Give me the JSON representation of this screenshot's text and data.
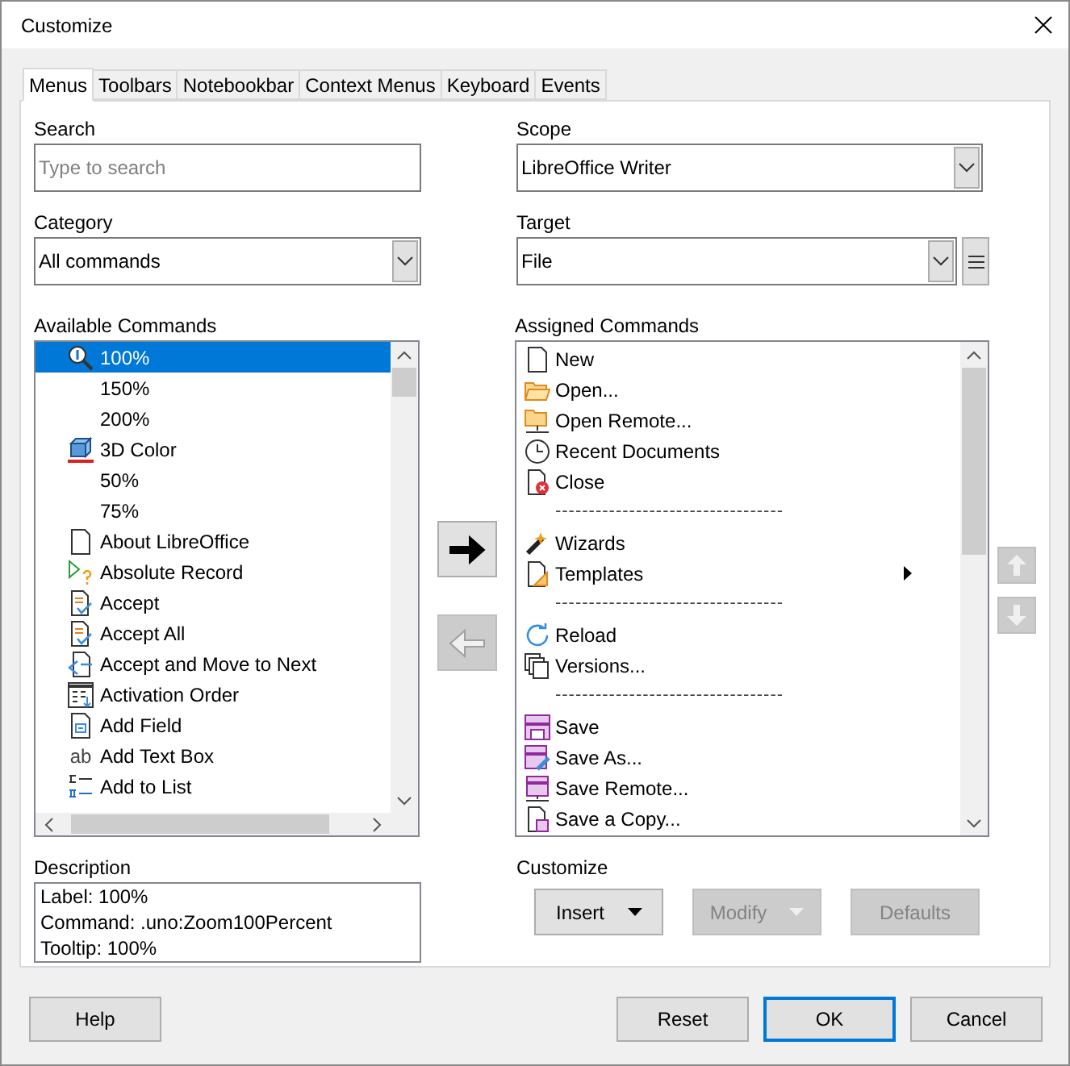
{
  "window": {
    "title": "Customize"
  },
  "tabs": [
    {
      "label": "Menus",
      "selected": true
    },
    {
      "label": "Toolbars",
      "selected": false
    },
    {
      "label": "Notebookbar",
      "selected": false
    },
    {
      "label": "Context Menus",
      "selected": false
    },
    {
      "label": "Keyboard",
      "selected": false
    },
    {
      "label": "Events",
      "selected": false
    }
  ],
  "search": {
    "label": "Search",
    "placeholder": "Type to search"
  },
  "scope": {
    "label": "Scope",
    "value": "LibreOffice Writer"
  },
  "category": {
    "label": "Category",
    "value": "All commands"
  },
  "target": {
    "label": "Target",
    "value": "File"
  },
  "available_commands": {
    "label": "Available Commands",
    "items": [
      {
        "label": "100%",
        "selected": true
      },
      {
        "label": "150%",
        "selected": false
      },
      {
        "label": "200%",
        "selected": false
      },
      {
        "label": "3D Color",
        "selected": false
      },
      {
        "label": "50%",
        "selected": false
      },
      {
        "label": "75%",
        "selected": false
      },
      {
        "label": "About LibreOffice",
        "selected": false
      },
      {
        "label": "Absolute Record",
        "selected": false
      },
      {
        "label": "Accept",
        "selected": false
      },
      {
        "label": "Accept All",
        "selected": false
      },
      {
        "label": "Accept and Move to Next",
        "selected": false
      },
      {
        "label": "Activation Order",
        "selected": false
      },
      {
        "label": "Add Field",
        "selected": false
      },
      {
        "label": "Add Text Box",
        "selected": false,
        "icon_text": "ab"
      },
      {
        "label": "Add to List",
        "selected": false
      }
    ]
  },
  "assigned_commands": {
    "label": "Assigned Commands",
    "items": [
      {
        "kind": "command",
        "label": "New"
      },
      {
        "kind": "command",
        "label": "Open..."
      },
      {
        "kind": "command",
        "label": "Open Remote..."
      },
      {
        "kind": "command",
        "label": "Recent Documents"
      },
      {
        "kind": "command",
        "label": "Close"
      },
      {
        "kind": "separator",
        "label": "----------------------------------"
      },
      {
        "kind": "command",
        "label": "Wizards"
      },
      {
        "kind": "command",
        "label": "Templates",
        "has_submenu": true
      },
      {
        "kind": "separator",
        "label": "----------------------------------"
      },
      {
        "kind": "command",
        "label": "Reload"
      },
      {
        "kind": "command",
        "label": "Versions..."
      },
      {
        "kind": "separator",
        "label": "----------------------------------"
      },
      {
        "kind": "command",
        "label": "Save"
      },
      {
        "kind": "command",
        "label": "Save As..."
      },
      {
        "kind": "command",
        "label": "Save Remote..."
      },
      {
        "kind": "command",
        "label": "Save a Copy..."
      }
    ]
  },
  "add_button": {
    "disabled": false
  },
  "remove_button": {
    "disabled": true
  },
  "move_up_button": {
    "disabled": true
  },
  "move_down_button": {
    "disabled": true
  },
  "description": {
    "label": "Description",
    "lines": [
      "Label: 100%",
      "Command: .uno:Zoom100Percent",
      "Tooltip: 100%"
    ]
  },
  "customize": {
    "label": "Customize",
    "buttons": [
      {
        "label": "Insert",
        "disabled": false,
        "dropdown": true
      },
      {
        "label": "Modify",
        "disabled": true,
        "dropdown": true
      },
      {
        "label": "Defaults",
        "disabled": true,
        "dropdown": false
      }
    ]
  },
  "footer_buttons": [
    {
      "label": "Help",
      "default": false
    },
    {
      "label": "Reset",
      "default": false
    },
    {
      "label": "OK",
      "default": true
    },
    {
      "label": "Cancel",
      "default": false
    }
  ]
}
